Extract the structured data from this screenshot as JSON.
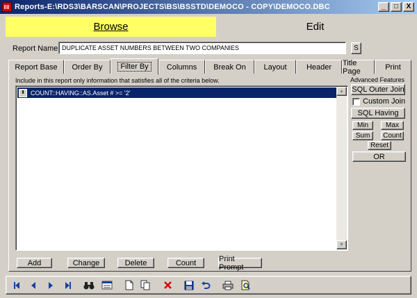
{
  "window": {
    "title": "Reports-E:\\RDS3\\BARSCAN\\PROJECTS\\BS\\BSSTD\\DEMOCO - COPY\\DEMOCO.DBC",
    "minimize": "_",
    "maximize": "□",
    "close": "X"
  },
  "mode": {
    "browse": "Browse",
    "edit": "Edit"
  },
  "report_name": {
    "label": "Report Name",
    "value": "DUPLICATE ASSET NUMBERS BETWEEN TWO COMPANIES",
    "s_button": "S"
  },
  "tabs": [
    {
      "label": "Report Base"
    },
    {
      "label": "Order By"
    },
    {
      "label": "Filter By",
      "active": true
    },
    {
      "label": "Columns"
    },
    {
      "label": "Break On"
    },
    {
      "label": "Layout"
    },
    {
      "label": "Header"
    },
    {
      "label": "Title Page"
    },
    {
      "label": "Print"
    }
  ],
  "filter": {
    "instruction": "Include in this report only information that satisfies all of the criteria below.",
    "criteria": [
      "COUNT::HAVING::AS.Asset # >= '2'"
    ]
  },
  "advanced": {
    "label": "Advanced Features",
    "sql_outer_join": "SQL Outer Join",
    "custom_join": "Custom Join",
    "sql_having": "SQL Having",
    "min": "Min",
    "max": "Max",
    "sum": "Sum",
    "count": "Count",
    "reset": "Reset",
    "or": "OR"
  },
  "actions": {
    "add": "Add",
    "change": "Change",
    "delete": "Delete",
    "count": "Count",
    "print_prompt": "Print Prompt"
  },
  "colors": {
    "selection": "#0a246a",
    "browse_highlight": "#ffff66",
    "face": "#d4d0c8"
  }
}
